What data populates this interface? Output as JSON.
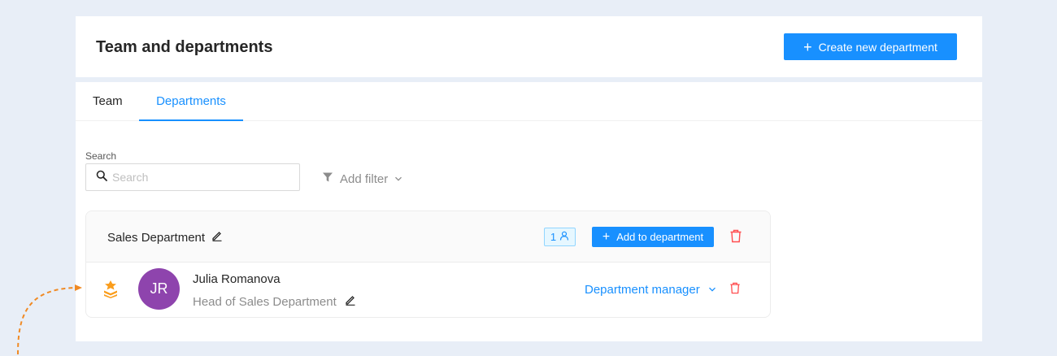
{
  "header": {
    "title": "Team and departments",
    "create_button_label": "Create new department"
  },
  "tabs": [
    {
      "label": "Team",
      "active": false
    },
    {
      "label": "Departments",
      "active": true
    }
  ],
  "search": {
    "label": "Search",
    "placeholder": "Search",
    "value": ""
  },
  "filter": {
    "label": "Add filter"
  },
  "department": {
    "name": "Sales Department",
    "member_count": "1",
    "add_button_label": "Add to department",
    "members": [
      {
        "initials": "JR",
        "name": "Julia Romanova",
        "title": "Head of Sales Department",
        "role": "Department manager"
      }
    ]
  },
  "colors": {
    "accent": "#1890ff",
    "danger": "#ff4d4f",
    "avatar": "#8e44ad",
    "manager_icon": "#fa9d1c",
    "page_background": "#e8eef7"
  },
  "icons": {
    "search": "search-icon",
    "filter": "filter-icon",
    "edit": "pencil-icon",
    "user": "user-icon",
    "delete": "trash-icon",
    "manager": "crown-stack-icon",
    "chevron": "chevron-down-icon"
  }
}
